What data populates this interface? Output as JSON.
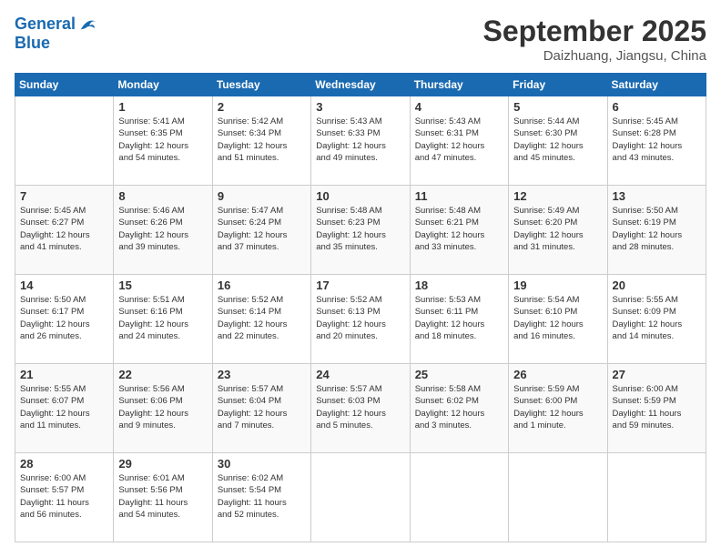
{
  "logo": {
    "line1": "General",
    "line2": "Blue"
  },
  "title": "September 2025",
  "location": "Daizhuang, Jiangsu, China",
  "headers": [
    "Sunday",
    "Monday",
    "Tuesday",
    "Wednesday",
    "Thursday",
    "Friday",
    "Saturday"
  ],
  "weeks": [
    [
      {
        "day": "",
        "info": ""
      },
      {
        "day": "1",
        "info": "Sunrise: 5:41 AM\nSunset: 6:35 PM\nDaylight: 12 hours\nand 54 minutes."
      },
      {
        "day": "2",
        "info": "Sunrise: 5:42 AM\nSunset: 6:34 PM\nDaylight: 12 hours\nand 51 minutes."
      },
      {
        "day": "3",
        "info": "Sunrise: 5:43 AM\nSunset: 6:33 PM\nDaylight: 12 hours\nand 49 minutes."
      },
      {
        "day": "4",
        "info": "Sunrise: 5:43 AM\nSunset: 6:31 PM\nDaylight: 12 hours\nand 47 minutes."
      },
      {
        "day": "5",
        "info": "Sunrise: 5:44 AM\nSunset: 6:30 PM\nDaylight: 12 hours\nand 45 minutes."
      },
      {
        "day": "6",
        "info": "Sunrise: 5:45 AM\nSunset: 6:28 PM\nDaylight: 12 hours\nand 43 minutes."
      }
    ],
    [
      {
        "day": "7",
        "info": "Sunrise: 5:45 AM\nSunset: 6:27 PM\nDaylight: 12 hours\nand 41 minutes."
      },
      {
        "day": "8",
        "info": "Sunrise: 5:46 AM\nSunset: 6:26 PM\nDaylight: 12 hours\nand 39 minutes."
      },
      {
        "day": "9",
        "info": "Sunrise: 5:47 AM\nSunset: 6:24 PM\nDaylight: 12 hours\nand 37 minutes."
      },
      {
        "day": "10",
        "info": "Sunrise: 5:48 AM\nSunset: 6:23 PM\nDaylight: 12 hours\nand 35 minutes."
      },
      {
        "day": "11",
        "info": "Sunrise: 5:48 AM\nSunset: 6:21 PM\nDaylight: 12 hours\nand 33 minutes."
      },
      {
        "day": "12",
        "info": "Sunrise: 5:49 AM\nSunset: 6:20 PM\nDaylight: 12 hours\nand 31 minutes."
      },
      {
        "day": "13",
        "info": "Sunrise: 5:50 AM\nSunset: 6:19 PM\nDaylight: 12 hours\nand 28 minutes."
      }
    ],
    [
      {
        "day": "14",
        "info": "Sunrise: 5:50 AM\nSunset: 6:17 PM\nDaylight: 12 hours\nand 26 minutes."
      },
      {
        "day": "15",
        "info": "Sunrise: 5:51 AM\nSunset: 6:16 PM\nDaylight: 12 hours\nand 24 minutes."
      },
      {
        "day": "16",
        "info": "Sunrise: 5:52 AM\nSunset: 6:14 PM\nDaylight: 12 hours\nand 22 minutes."
      },
      {
        "day": "17",
        "info": "Sunrise: 5:52 AM\nSunset: 6:13 PM\nDaylight: 12 hours\nand 20 minutes."
      },
      {
        "day": "18",
        "info": "Sunrise: 5:53 AM\nSunset: 6:11 PM\nDaylight: 12 hours\nand 18 minutes."
      },
      {
        "day": "19",
        "info": "Sunrise: 5:54 AM\nSunset: 6:10 PM\nDaylight: 12 hours\nand 16 minutes."
      },
      {
        "day": "20",
        "info": "Sunrise: 5:55 AM\nSunset: 6:09 PM\nDaylight: 12 hours\nand 14 minutes."
      }
    ],
    [
      {
        "day": "21",
        "info": "Sunrise: 5:55 AM\nSunset: 6:07 PM\nDaylight: 12 hours\nand 11 minutes."
      },
      {
        "day": "22",
        "info": "Sunrise: 5:56 AM\nSunset: 6:06 PM\nDaylight: 12 hours\nand 9 minutes."
      },
      {
        "day": "23",
        "info": "Sunrise: 5:57 AM\nSunset: 6:04 PM\nDaylight: 12 hours\nand 7 minutes."
      },
      {
        "day": "24",
        "info": "Sunrise: 5:57 AM\nSunset: 6:03 PM\nDaylight: 12 hours\nand 5 minutes."
      },
      {
        "day": "25",
        "info": "Sunrise: 5:58 AM\nSunset: 6:02 PM\nDaylight: 12 hours\nand 3 minutes."
      },
      {
        "day": "26",
        "info": "Sunrise: 5:59 AM\nSunset: 6:00 PM\nDaylight: 12 hours\nand 1 minute."
      },
      {
        "day": "27",
        "info": "Sunrise: 6:00 AM\nSunset: 5:59 PM\nDaylight: 11 hours\nand 59 minutes."
      }
    ],
    [
      {
        "day": "28",
        "info": "Sunrise: 6:00 AM\nSunset: 5:57 PM\nDaylight: 11 hours\nand 56 minutes."
      },
      {
        "day": "29",
        "info": "Sunrise: 6:01 AM\nSunset: 5:56 PM\nDaylight: 11 hours\nand 54 minutes."
      },
      {
        "day": "30",
        "info": "Sunrise: 6:02 AM\nSunset: 5:54 PM\nDaylight: 11 hours\nand 52 minutes."
      },
      {
        "day": "",
        "info": ""
      },
      {
        "day": "",
        "info": ""
      },
      {
        "day": "",
        "info": ""
      },
      {
        "day": "",
        "info": ""
      }
    ]
  ]
}
